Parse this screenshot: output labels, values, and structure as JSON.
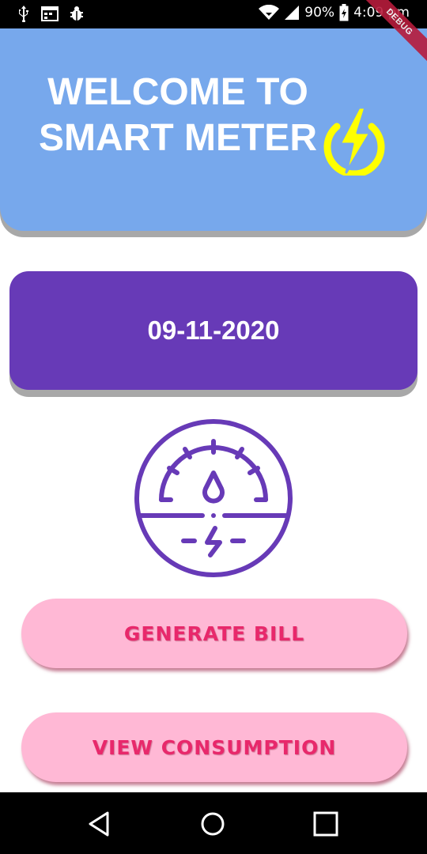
{
  "status_bar": {
    "battery": "90%",
    "time": "4:09 pm",
    "icons": [
      "usb-icon",
      "calendar-icon",
      "bug-icon",
      "wifi-icon",
      "signal-icon",
      "battery-icon"
    ]
  },
  "debug_banner": "DEBUG",
  "header": {
    "title": "WELCOME TO SMART METER",
    "logo_icon": "lightning-bolt-icon",
    "background": "#77a8ec",
    "logo_color": "#ffff00"
  },
  "date_card": {
    "date": "09-11-2020",
    "background": "#673ab7"
  },
  "meter": {
    "icon": "smart-meter-gauge-icon",
    "color": "#673ab7"
  },
  "actions": {
    "generate_bill": "GENERATE BILL",
    "view_consumption": "VIEW CONSUMPTION",
    "button_background": "#ffb8d5",
    "button_text_color": "#e8286b"
  },
  "nav_bar": {
    "icons": [
      "back-icon",
      "home-icon",
      "recents-icon"
    ]
  }
}
